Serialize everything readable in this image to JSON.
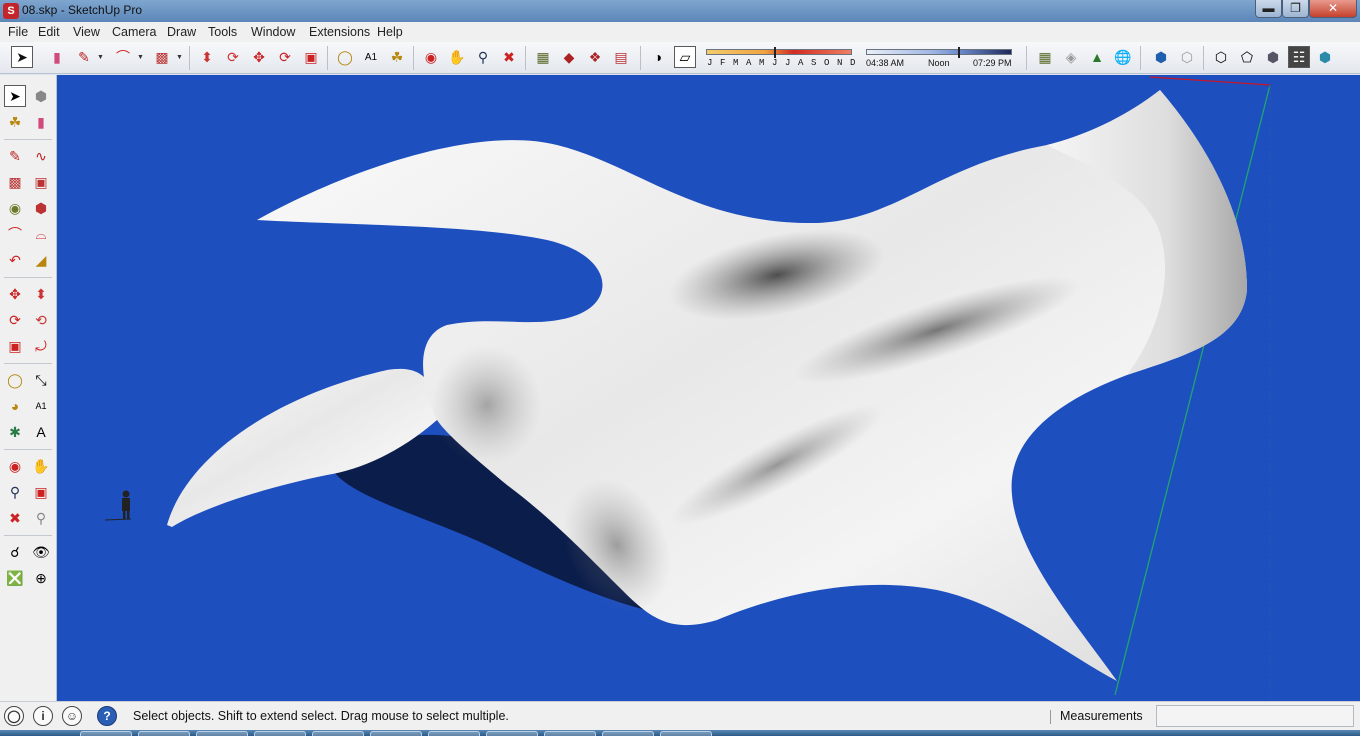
{
  "window": {
    "title": "08.skp - SketchUp Pro",
    "app_icon": "sketchup-icon",
    "controls": [
      "minimize-icon",
      "maximize-icon",
      "close-icon"
    ]
  },
  "menu": [
    "File",
    "Edit",
    "View",
    "Camera",
    "Draw",
    "Tools",
    "Window",
    "Extensions",
    "Help"
  ],
  "toolbar": {
    "shadow_months": "J F M A M J J A S O N D",
    "time_start": "04:38 AM",
    "time_noon": "Noon",
    "time_end": "07:29 PM"
  },
  "status": {
    "message": "Select objects. Shift to extend select. Drag mouse to select multiple.",
    "measurements_label": "Measurements",
    "measurements_value": ""
  },
  "colors": {
    "viewport_sky": "#1d4fbf",
    "surface": "#f2f2f2",
    "shadow": "#0b1d4a",
    "axis_green": "#1fa66e",
    "axis_red": "#c8152a"
  }
}
